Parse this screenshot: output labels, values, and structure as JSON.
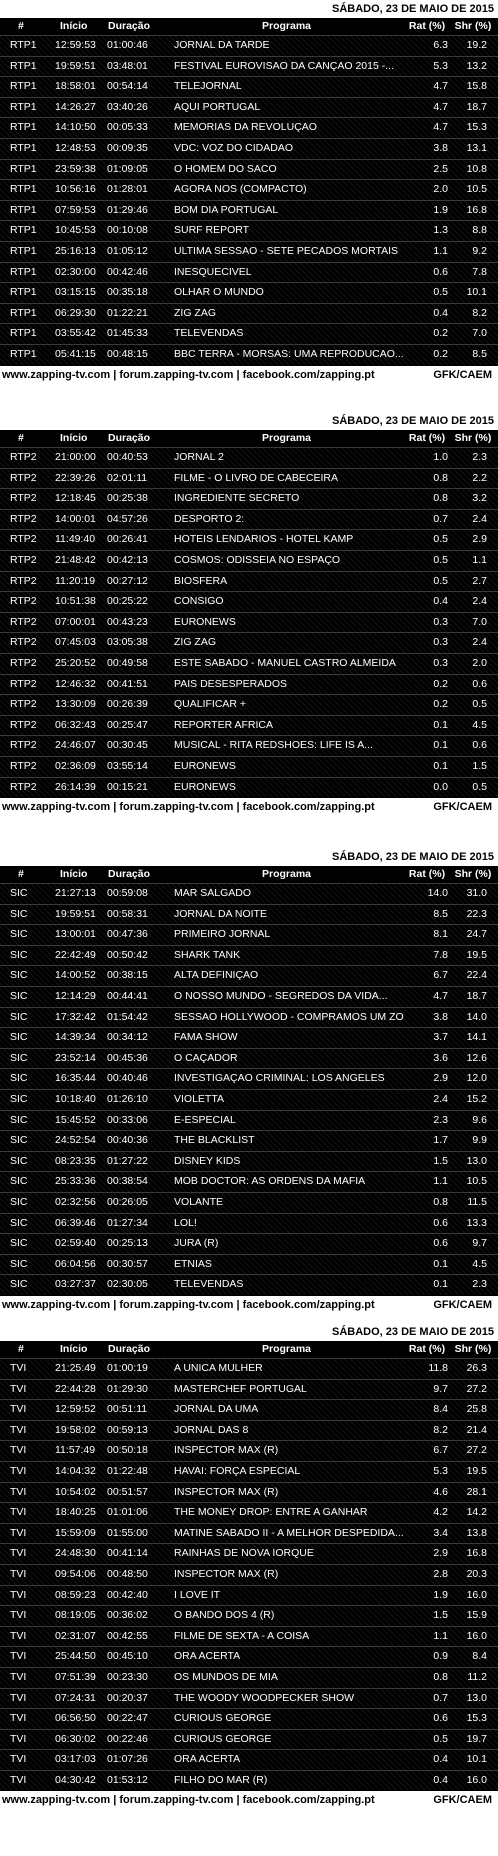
{
  "headers": {
    "num": "#",
    "inicio": "Início",
    "duracao": "Duração",
    "programa": "Programa",
    "rat": "Rat (%)",
    "shr": "Shr (%)"
  },
  "footer": {
    "site": "www.zapping-tv.com | forum.zapping-tv.com | facebook.com/zapping.pt",
    "source": "GFK/CAEM"
  },
  "tables": [
    {
      "date": "SÁBADO, 23 DE MAIO DE 2015",
      "rows": [
        [
          "RTP1",
          "12:59:53",
          "01:00:46",
          "JORNAL DA TARDE",
          "6.3",
          "19.2"
        ],
        [
          "RTP1",
          "19:59:51",
          "03:48:01",
          "FESTIVAL EUROVISAO DA CANÇAO 2015 -...",
          "5.3",
          "13.2"
        ],
        [
          "RTP1",
          "18:58:01",
          "00:54:14",
          "TELEJORNAL",
          "4.7",
          "15.8"
        ],
        [
          "RTP1",
          "14:26:27",
          "03:40:26",
          "AQUI PORTUGAL",
          "4.7",
          "18.7"
        ],
        [
          "RTP1",
          "14:10:50",
          "00:05:33",
          "MEMORIAS DA REVOLUÇAO",
          "4.7",
          "15.3"
        ],
        [
          "RTP1",
          "12:48:53",
          "00:09:35",
          "VDC: VOZ DO CIDADAO",
          "3.8",
          "13.1"
        ],
        [
          "RTP1",
          "23:59:38",
          "01:09:05",
          "O HOMEM DO SACO",
          "2.5",
          "10.8"
        ],
        [
          "RTP1",
          "10:56:16",
          "01:28:01",
          "AGORA NOS (COMPACTO)",
          "2.0",
          "10.5"
        ],
        [
          "RTP1",
          "07:59:53",
          "01:29:46",
          "BOM DIA PORTUGAL",
          "1.9",
          "16.8"
        ],
        [
          "RTP1",
          "10:45:53",
          "00:10:08",
          "SURF REPORT",
          "1.3",
          "8.8"
        ],
        [
          "RTP1",
          "25:16:13",
          "01:05:12",
          "ULTIMA SESSAO - SETE PECADOS MORTAIS",
          "1.1",
          "9.2"
        ],
        [
          "RTP1",
          "02:30:00",
          "00:42:46",
          "INESQUECIVEL",
          "0.6",
          "7.8"
        ],
        [
          "RTP1",
          "03:15:15",
          "00:35:18",
          "OLHAR O MUNDO",
          "0.5",
          "10.1"
        ],
        [
          "RTP1",
          "06:29:30",
          "01:22:21",
          "ZIG ZAG",
          "0.4",
          "8.2"
        ],
        [
          "RTP1",
          "03:55:42",
          "01:45:33",
          "TELEVENDAS",
          "0.2",
          "7.0"
        ],
        [
          "RTP1",
          "05:41:15",
          "00:48:15",
          "BBC TERRA - MORSAS: UMA REPRODUCAO...",
          "0.2",
          "8.5"
        ]
      ]
    },
    {
      "date": "SÁBADO, 23 DE MAIO DE 2015",
      "rows": [
        [
          "RTP2",
          "21:00:00",
          "00:40:53",
          "JORNAL 2",
          "1.0",
          "2.3"
        ],
        [
          "RTP2",
          "22:39:26",
          "02:01:11",
          "FILME - O LIVRO DE CABECEIRA",
          "0.8",
          "2.2"
        ],
        [
          "RTP2",
          "12:18:45",
          "00:25:38",
          "INGREDIENTE SECRETO",
          "0.8",
          "3.2"
        ],
        [
          "RTP2",
          "14:00:01",
          "04:57:26",
          "DESPORTO 2:",
          "0.7",
          "2.4"
        ],
        [
          "RTP2",
          "11:49:40",
          "00:26:41",
          "HOTEIS LENDARIOS - HOTEL KAMP",
          "0.5",
          "2.9"
        ],
        [
          "RTP2",
          "21:48:42",
          "00:42:13",
          "COSMOS: ODISSEIA NO ESPAÇO",
          "0.5",
          "1.1"
        ],
        [
          "RTP2",
          "11:20:19",
          "00:27:12",
          "BIOSFERA",
          "0.5",
          "2.7"
        ],
        [
          "RTP2",
          "10:51:38",
          "00:25:22",
          "CONSIGO",
          "0.4",
          "2.4"
        ],
        [
          "RTP2",
          "07:00:01",
          "00:43:23",
          "EURONEWS",
          "0.3",
          "7.0"
        ],
        [
          "RTP2",
          "07:45:03",
          "03:05:38",
          "ZIG ZAG",
          "0.3",
          "2.4"
        ],
        [
          "RTP2",
          "25:20:52",
          "00:49:58",
          "ESTE SABADO - MANUEL CASTRO ALMEIDA",
          "0.3",
          "2.0"
        ],
        [
          "RTP2",
          "12:46:32",
          "00:41:51",
          "PAIS DESESPERADOS",
          "0.2",
          "0.6"
        ],
        [
          "RTP2",
          "13:30:09",
          "00:26:39",
          "QUALIFICAR +",
          "0.2",
          "0.5"
        ],
        [
          "RTP2",
          "06:32:43",
          "00:25:47",
          "REPORTER AFRICA",
          "0.1",
          "4.5"
        ],
        [
          "RTP2",
          "24:46:07",
          "00:30:45",
          "MUSICAL - RITA REDSHOES: LIFE IS A...",
          "0.1",
          "0.6"
        ],
        [
          "RTP2",
          "02:36:09",
          "03:55:14",
          "EURONEWS",
          "0.1",
          "1.5"
        ],
        [
          "RTP2",
          "26:14:39",
          "00:15:21",
          "EURONEWS",
          "0.0",
          "0.5"
        ]
      ]
    },
    {
      "date": "SÁBADO, 23 DE MAIO DE 2015",
      "rows": [
        [
          "SIC",
          "21:27:13",
          "00:59:08",
          "MAR SALGADO",
          "14.0",
          "31.0"
        ],
        [
          "SIC",
          "19:59:51",
          "00:58:31",
          "JORNAL DA NOITE",
          "8.5",
          "22.3"
        ],
        [
          "SIC",
          "13:00:01",
          "00:47:36",
          "PRIMEIRO JORNAL",
          "8.1",
          "24.7"
        ],
        [
          "SIC",
          "22:42:49",
          "00:50:42",
          "SHARK TANK",
          "7.8",
          "19.5"
        ],
        [
          "SIC",
          "14:00:52",
          "00:38:15",
          "ALTA DEFINIÇAO",
          "6.7",
          "22.4"
        ],
        [
          "SIC",
          "12:14:29",
          "00:44:41",
          "O NOSSO MUNDO - SEGREDOS DA VIDA...",
          "4.7",
          "18.7"
        ],
        [
          "SIC",
          "17:32:42",
          "01:54:42",
          "SESSAO HOLLYWOOD - COMPRAMOS UM ZO",
          "3.8",
          "14.0"
        ],
        [
          "SIC",
          "14:39:34",
          "00:34:12",
          "FAMA SHOW",
          "3.7",
          "14.1"
        ],
        [
          "SIC",
          "23:52:14",
          "00:45:36",
          "O CAÇADOR",
          "3.6",
          "12.6"
        ],
        [
          "SIC",
          "16:35:44",
          "00:40:46",
          "INVESTIGAÇAO CRIMINAL: LOS ANGELES",
          "2.9",
          "12.0"
        ],
        [
          "SIC",
          "10:18:40",
          "01:26:10",
          "VIOLETTA",
          "2.4",
          "15.2"
        ],
        [
          "SIC",
          "15:45:52",
          "00:33:06",
          "E-ESPECIAL",
          "2.3",
          "9.6"
        ],
        [
          "SIC",
          "24:52:54",
          "00:40:36",
          "THE BLACKLIST",
          "1.7",
          "9.9"
        ],
        [
          "SIC",
          "08:23:35",
          "01:27:22",
          "DISNEY KIDS",
          "1.5",
          "13.0"
        ],
        [
          "SIC",
          "25:33:36",
          "00:38:54",
          "MOB DOCTOR: AS ORDENS DA MAFIA",
          "1.1",
          "10.5"
        ],
        [
          "SIC",
          "02:32:56",
          "00:26:05",
          "VOLANTE",
          "0.8",
          "11.5"
        ],
        [
          "SIC",
          "06:39:46",
          "01:27:34",
          "LOL!",
          "0.6",
          "13.3"
        ],
        [
          "SIC",
          "02:59:40",
          "00:25:13",
          "JURA (R)",
          "0.6",
          "9.7"
        ],
        [
          "SIC",
          "06:04:56",
          "00:30:57",
          "ETNIAS",
          "0.1",
          "4.5"
        ],
        [
          "SIC",
          "03:27:37",
          "02:30:05",
          "TELEVENDAS",
          "0.1",
          "2.3"
        ]
      ]
    },
    {
      "date": "SÁBADO, 23 DE MAIO DE 2015",
      "rows": [
        [
          "TVI",
          "21:25:49",
          "01:00:19",
          "A UNICA MULHER",
          "11.8",
          "26.3"
        ],
        [
          "TVI",
          "22:44:28",
          "01:29:30",
          "MASTERCHEF PORTUGAL",
          "9.7",
          "27.2"
        ],
        [
          "TVI",
          "12:59:52",
          "00:51:11",
          "JORNAL DA UMA",
          "8.4",
          "25.8"
        ],
        [
          "TVI",
          "19:58:02",
          "00:59:13",
          "JORNAL DAS 8",
          "8.2",
          "21.4"
        ],
        [
          "TVI",
          "11:57:49",
          "00:50:18",
          "INSPECTOR MAX (R)",
          "6.7",
          "27.2"
        ],
        [
          "TVI",
          "14:04:32",
          "01:22:48",
          "HAVAI: FORÇA ESPECIAL",
          "5.3",
          "19.5"
        ],
        [
          "TVI",
          "10:54:02",
          "00:51:57",
          "INSPECTOR MAX (R)",
          "4.6",
          "28.1"
        ],
        [
          "TVI",
          "18:40:25",
          "01:01:06",
          "THE MONEY DROP: ENTRE A GANHAR",
          "4.2",
          "14.2"
        ],
        [
          "TVI",
          "15:59:09",
          "01:55:00",
          "MATINE SABADO II - A MELHOR DESPEDIDA...",
          "3.4",
          "13.8"
        ],
        [
          "TVI",
          "24:48:30",
          "00:41:14",
          "RAINHAS DE NOVA IORQUE",
          "2.9",
          "16.8"
        ],
        [
          "TVI",
          "09:54:06",
          "00:48:50",
          "INSPECTOR MAX (R)",
          "2.8",
          "20.3"
        ],
        [
          "TVI",
          "08:59:23",
          "00:42:40",
          "I LOVE IT",
          "1.9",
          "16.0"
        ],
        [
          "TVI",
          "08:19:05",
          "00:36:02",
          "O BANDO DOS 4 (R)",
          "1.5",
          "15.9"
        ],
        [
          "TVI",
          "02:31:07",
          "00:42:55",
          "FILME DE SEXTA - A COISA",
          "1.1",
          "16.0"
        ],
        [
          "TVI",
          "25:44:50",
          "00:45:10",
          "ORA ACERTA",
          "0.9",
          "8.4"
        ],
        [
          "TVI",
          "07:51:39",
          "00:23:30",
          "OS MUNDOS DE MIA",
          "0.8",
          "11.2"
        ],
        [
          "TVI",
          "07:24:31",
          "00:20:37",
          "THE WOODY WOODPECKER SHOW",
          "0.7",
          "13.0"
        ],
        [
          "TVI",
          "06:56:50",
          "00:22:47",
          "CURIOUS GEORGE",
          "0.6",
          "15.3"
        ],
        [
          "TVI",
          "06:30:02",
          "00:22:46",
          "CURIOUS GEORGE",
          "0.5",
          "19.7"
        ],
        [
          "TVI",
          "03:17:03",
          "01:07:26",
          "ORA ACERTA",
          "0.4",
          "10.1"
        ],
        [
          "TVI",
          "04:30:42",
          "01:53:12",
          "FILHO DO MAR (R)",
          "0.4",
          "16.0"
        ]
      ]
    }
  ]
}
